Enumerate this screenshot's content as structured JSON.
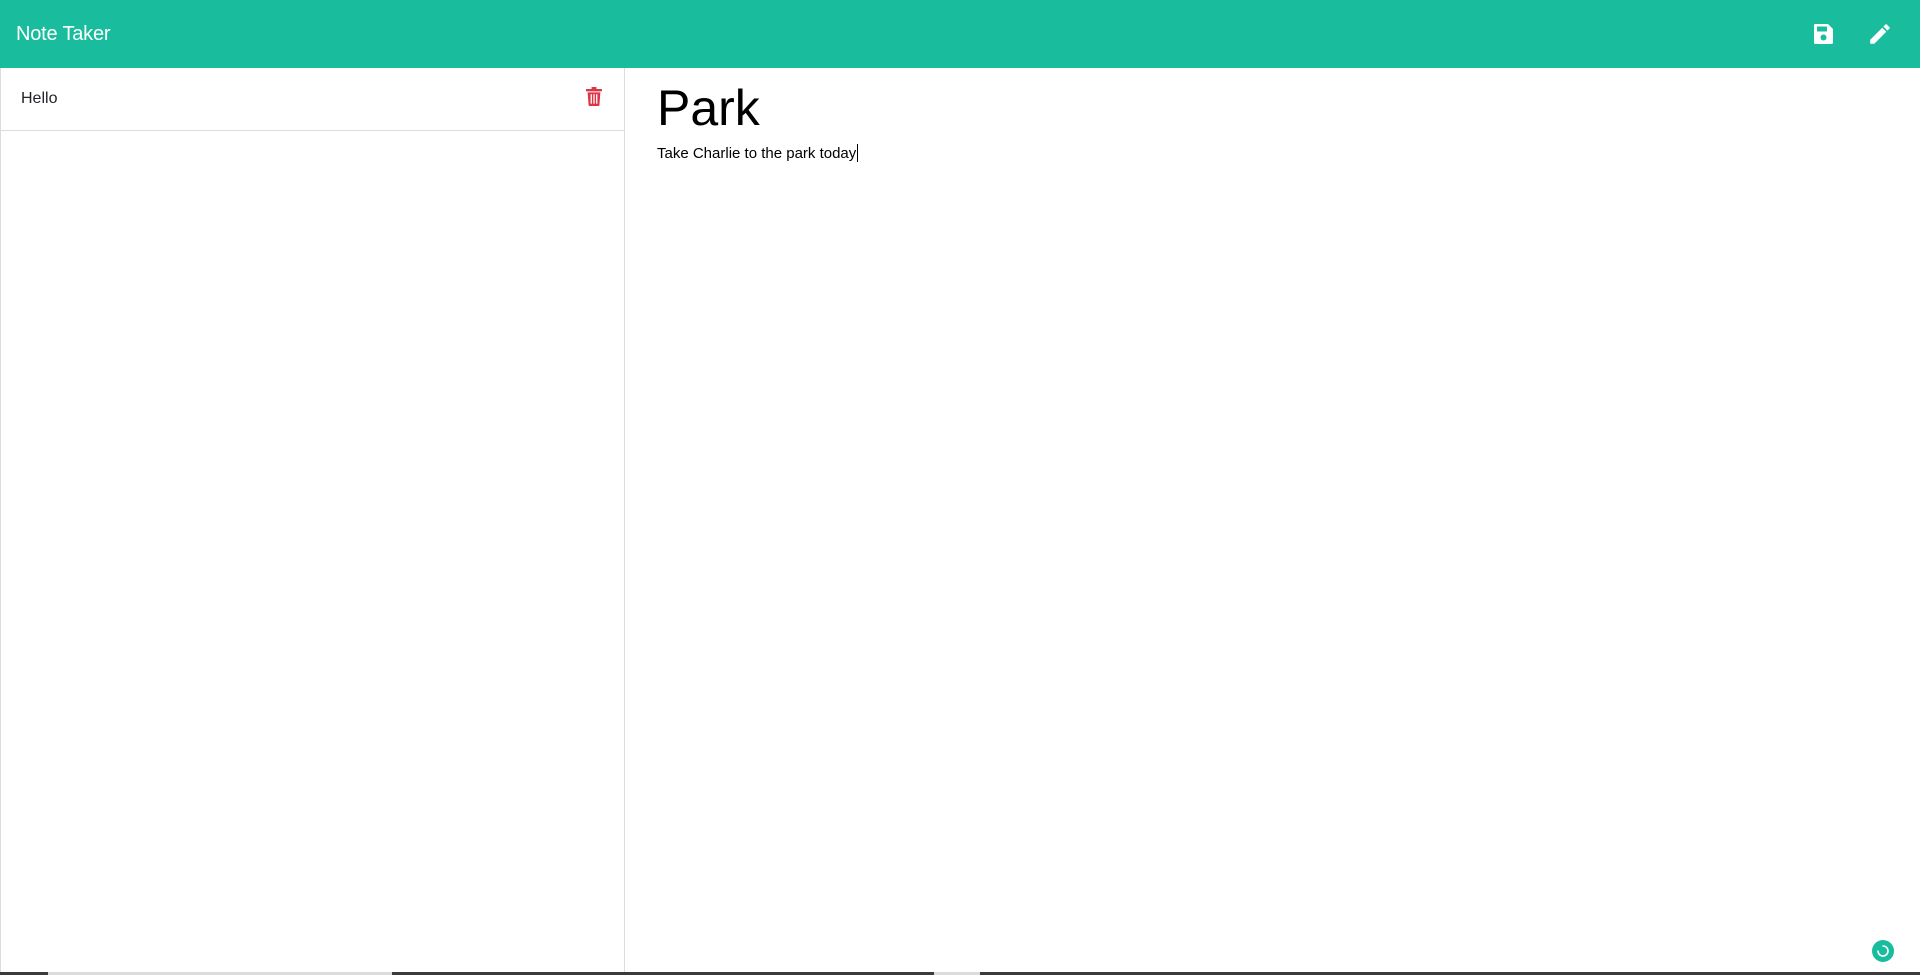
{
  "app": {
    "title": "Note Taker",
    "accent_color": "#19bc9c",
    "danger_color": "#dc3545"
  },
  "toolbar": {
    "save_icon": "floppy-disk-icon",
    "new_note_icon": "pencil-icon"
  },
  "sidebar": {
    "notes": [
      {
        "title": "Hello",
        "delete_icon": "trash-icon"
      }
    ]
  },
  "editor": {
    "title": "Park",
    "text": "Take Charlie to the park today"
  }
}
